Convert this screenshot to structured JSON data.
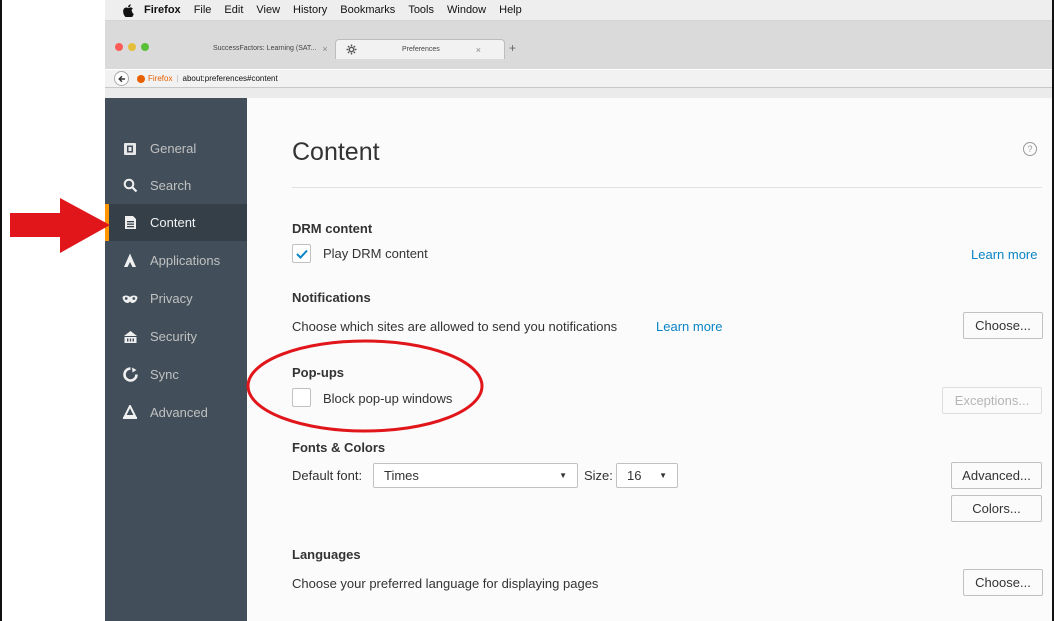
{
  "menubar": {
    "items": [
      "Firefox",
      "File",
      "Edit",
      "View",
      "History",
      "Bookmarks",
      "Tools",
      "Window",
      "Help"
    ]
  },
  "tabs": [
    {
      "label": "SuccessFactors: Learning (SAT...",
      "close": "×"
    },
    {
      "label": "Preferences",
      "close": "×"
    }
  ],
  "newtab_label": "+",
  "urlbar": {
    "identity": "Firefox",
    "url": "about:preferences#content"
  },
  "sidebar": {
    "items": [
      {
        "label": "General",
        "icon": "general-icon"
      },
      {
        "label": "Search",
        "icon": "search-icon"
      },
      {
        "label": "Content",
        "icon": "content-icon"
      },
      {
        "label": "Applications",
        "icon": "applications-icon"
      },
      {
        "label": "Privacy",
        "icon": "privacy-mask-icon"
      },
      {
        "label": "Security",
        "icon": "security-icon"
      },
      {
        "label": "Sync",
        "icon": "sync-icon"
      },
      {
        "label": "Advanced",
        "icon": "advanced-icon"
      }
    ],
    "active": "Content"
  },
  "page": {
    "title": "Content",
    "help_label": "?"
  },
  "drm": {
    "heading": "DRM content",
    "checkbox_label": "Play DRM content",
    "checked": true,
    "learn_more": "Learn more"
  },
  "notifications": {
    "heading": "Notifications",
    "text": "Choose which sites are allowed to send you notifications",
    "learn_more": "Learn more",
    "button": "Choose..."
  },
  "popups": {
    "heading": "Pop-ups",
    "checkbox_label": "Block pop-up windows",
    "checked": false,
    "button": "Exceptions..."
  },
  "fonts": {
    "heading": "Fonts & Colors",
    "default_font_label": "Default font:",
    "default_font_value": "Times",
    "size_label": "Size:",
    "size_value": "16",
    "advanced_button": "Advanced...",
    "colors_button": "Colors..."
  },
  "languages": {
    "heading": "Languages",
    "text": "Choose your preferred language for displaying pages",
    "button": "Choose..."
  },
  "colors": {
    "sidebar_bg": "#424f5a",
    "sidebar_active": "#343f48",
    "accent": "#ff9500",
    "link": "#0a84c6",
    "annotation_red": "#e0161b"
  }
}
